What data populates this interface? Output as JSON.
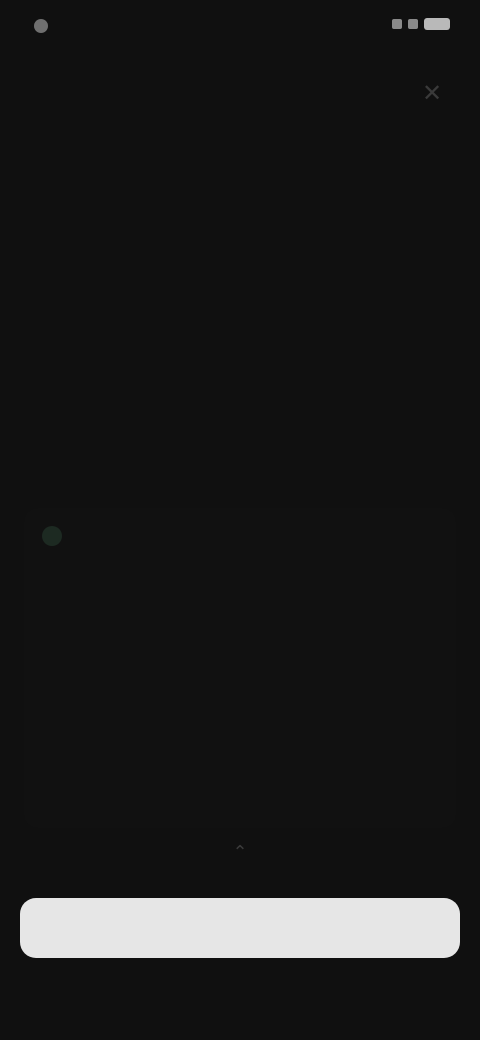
{
  "status_bar": {
    "time": "",
    "icons": [
      "signal-icon",
      "wifi-icon",
      "battery-icon"
    ]
  },
  "header": {
    "close_icon": "close-icon",
    "title": "",
    "subtitle": ""
  },
  "card": {
    "icon": "status-dot-icon",
    "title": "",
    "body": "",
    "stats": [
      {
        "value": "",
        "label": ""
      },
      {
        "value": "",
        "label": ""
      },
      {
        "value": "",
        "label": ""
      }
    ],
    "link_label": ""
  },
  "footer": {
    "chevron_icon": "chevron-up-icon",
    "primary_button_label": "",
    "footnote": ""
  },
  "colors": {
    "background": "#101010",
    "button_bg": "#e6e6e6",
    "accent_dot": "#1d2a22"
  }
}
